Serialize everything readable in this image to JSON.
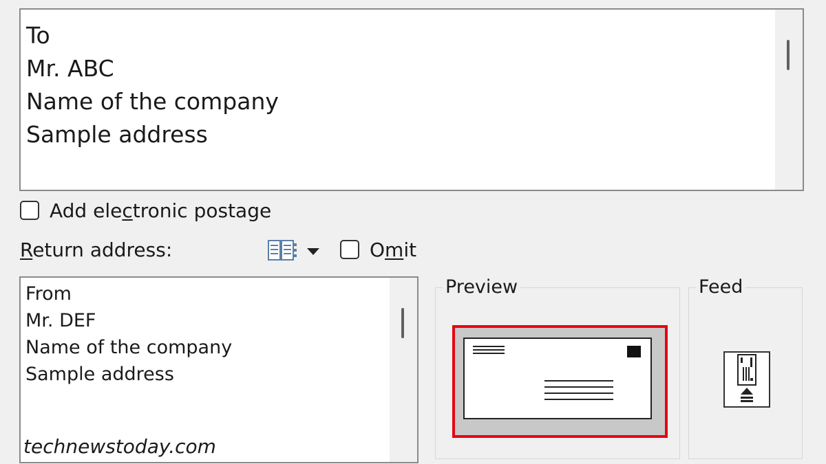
{
  "delivery_address": {
    "lines": "To\nMr. ABC\nName of the company\nSample address"
  },
  "electronic_postage": {
    "label_before": "Add ele",
    "label_accel": "c",
    "label_after": "tronic postage",
    "checked": false
  },
  "return_address": {
    "label_accel": "R",
    "label_rest": "eturn address:",
    "address_book_icon": "address-book-icon",
    "dropdown_icon": "dropdown-arrow-icon",
    "omit_before": "O",
    "omit_accel": "m",
    "omit_after": "it",
    "omit_checked": false,
    "lines": "From\nMr. DEF\nName of the company\nSample address"
  },
  "preview": {
    "title": "Preview",
    "highlight_color": "#e30613"
  },
  "feed": {
    "title": "Feed",
    "icon": "envelope-feed-icon"
  },
  "watermark": "technewstoday.com"
}
